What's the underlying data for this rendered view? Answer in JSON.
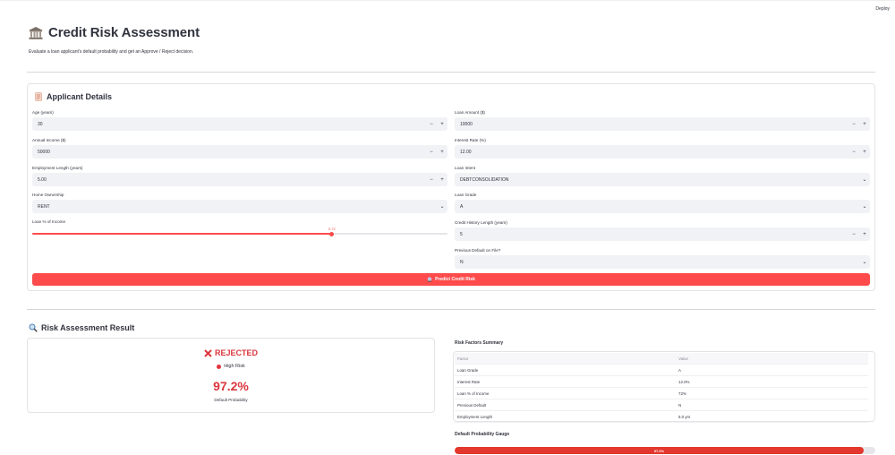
{
  "header": {
    "deploy_label": "Deploy",
    "title": "Credit Risk Assessment",
    "subtitle": "Evaluate a loan applicant's default probability and get an Approve / Reject decision."
  },
  "applicant": {
    "heading": "Applicant Details",
    "age": {
      "label": "Age (years)",
      "value": "30"
    },
    "income": {
      "label": "Annual Income ($)",
      "value": "50000"
    },
    "emp_length": {
      "label": "Employment Length (years)",
      "value": "5.00"
    },
    "home": {
      "label": "Home Ownership",
      "value": "RENT"
    },
    "loan_pct": {
      "label": "Loan % of Income",
      "value_text": "0.72",
      "fraction": 0.72
    },
    "loan_amount": {
      "label": "Loan Amount ($)",
      "value": "10000"
    },
    "interest": {
      "label": "Interest Rate (%)",
      "value": "12.00"
    },
    "intent": {
      "label": "Loan Intent",
      "value": "DEBTCONSOLIDATION"
    },
    "grade": {
      "label": "Loan Grade",
      "value": "A"
    },
    "history": {
      "label": "Credit History Length (years)",
      "value": "5"
    },
    "default": {
      "label": "Previous Default on File?",
      "value": "N"
    },
    "minus": "−",
    "plus": "+",
    "predict_label": "Predict Credit Risk"
  },
  "result": {
    "heading": "Risk Assessment Result",
    "decision": "REJECTED",
    "risk_label": "High Risk",
    "probability": "97.2%",
    "probability_label": "Default Probability",
    "summary_heading": "Risk Factors Summary",
    "table": {
      "headers": [
        "Factor",
        "Value"
      ],
      "rows": [
        [
          "Loan Grade",
          "A"
        ],
        [
          "Interest Rate",
          "12.0%"
        ],
        [
          "Loan % of Income",
          "72%"
        ],
        [
          "Previous Default",
          "N"
        ],
        [
          "Employment Length",
          "5.0 yrs"
        ]
      ]
    },
    "gauge_heading": "Default Probability Gauge",
    "gauge_text": "97.2%",
    "gauge_fraction": 0.972
  },
  "colors": {
    "accent": "#ff4b4b",
    "reject": "#d9363e"
  }
}
